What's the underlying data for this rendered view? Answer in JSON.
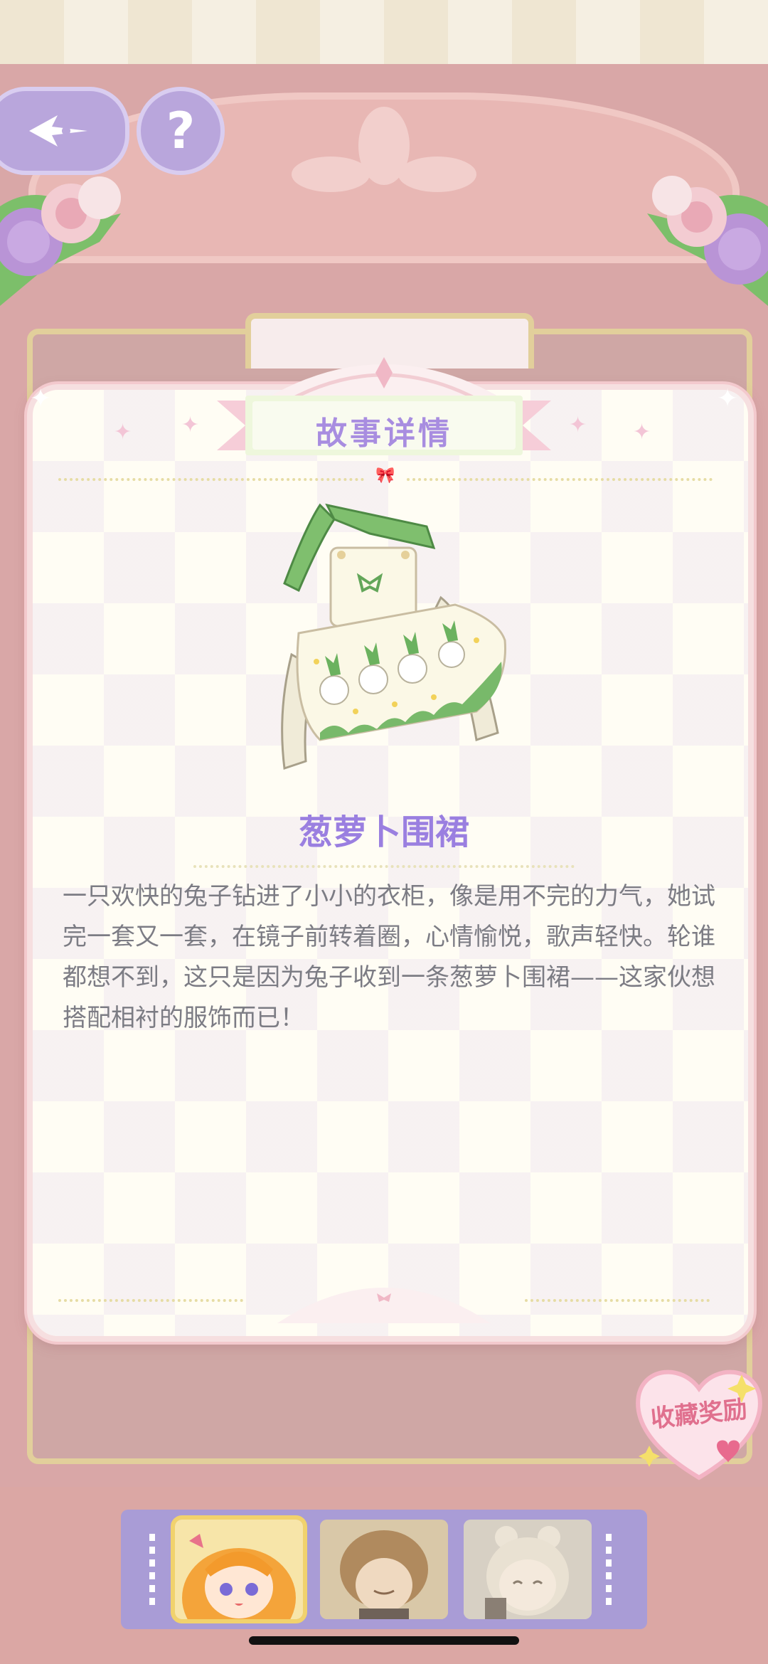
{
  "popup": {
    "title": "故事详情",
    "item_name": "葱萝卜围裙",
    "description": "一只欢快的兔子钻进了小小的衣柜，像是用不完的力气，她试完一套又一套，在镜子前转着圈，心情愉悦，歌声轻快。轮谁都想不到，这只是因为兔子收到一条葱萝卜围裙——这家伙想搭配相衬的服饰而已！"
  },
  "buttons": {
    "help_label": "?"
  },
  "reward_badge": {
    "label": "收藏奖励"
  },
  "characters": [
    {
      "name": "orange-hair-girl",
      "selected": true
    },
    {
      "name": "brown-hair-boy",
      "selected": false
    },
    {
      "name": "white-hair-girl",
      "selected": false
    }
  ],
  "colors": {
    "accent_purple": "#a88de0",
    "text_gray": "#7c7c84",
    "frame_pink": "#d9a7a7",
    "reward_pink": "#e0708e"
  }
}
